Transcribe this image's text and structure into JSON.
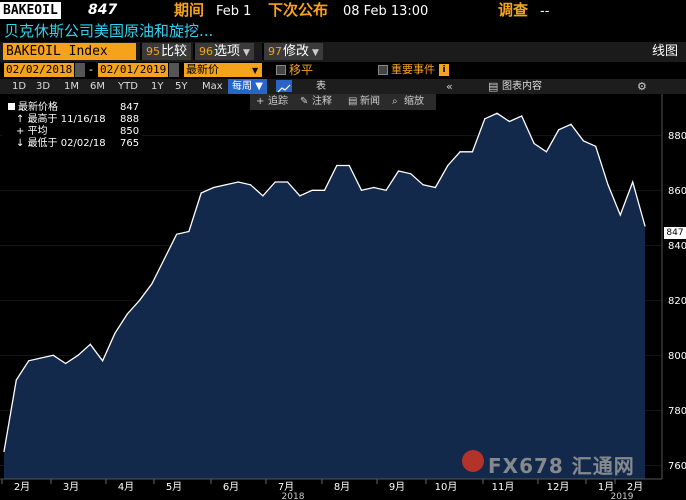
{
  "header": {
    "ticker": "BAKEOIL",
    "price": "847",
    "period_label": "期间",
    "period_value": "Feb 1",
    "next_label": "下次公布",
    "next_value": "08 Feb 13:00",
    "survey_label": "调查",
    "survey_value": "--",
    "name": "贝克休斯公司美国原油和旋挖..."
  },
  "toolbar": {
    "ticker_input": "BAKEOIL Index",
    "compare_num": "95",
    "compare_label": "比较",
    "options_num": "96",
    "options_label": "选项",
    "edit_num": "97",
    "edit_label": "修改",
    "chart_type_label": "线图"
  },
  "range_bar": {
    "start_date": "02/02/2018",
    "end_date": "02/01/2019",
    "price_type": "最新价",
    "moving_label": "移平",
    "events_label": "重要事件"
  },
  "period_bar": {
    "periods": [
      "1D",
      "3D",
      "1M",
      "6M",
      "YTD",
      "1Y",
      "5Y",
      "Max"
    ],
    "frequency": "每周",
    "table_label": "表",
    "chart_content_label": "图表内容"
  },
  "mini_toolbar": {
    "track": "追踪",
    "annotate": "注释",
    "news": "新闻",
    "zoom": "缩放"
  },
  "legend": {
    "last_label": "最新价格",
    "last_value": "847",
    "high_label": "最高于 11/16/18",
    "high_value": "888",
    "avg_label": "平均",
    "avg_value": "850",
    "low_label": "最低于 02/02/18",
    "low_value": "765"
  },
  "watermark": "FX678 汇通网",
  "colors": {
    "orange": "#f6a31c",
    "cyan": "#2fd3f0",
    "area": "#13294b",
    "line": "#ffffff"
  },
  "chart_data": {
    "type": "area",
    "ylim": [
      755,
      895
    ],
    "y_ticks": [
      760,
      780,
      800,
      820,
      840,
      860,
      880
    ],
    "x_ticks": [
      "2月",
      "3月",
      "4月",
      "5月",
      "6月",
      "7月",
      "8月",
      "9月",
      "10月",
      "11月",
      "12月",
      "1月",
      "2月"
    ],
    "year_labels": [
      "2018",
      "2019"
    ],
    "current_value": "847",
    "series": [
      {
        "values": [
          765,
          791,
          798,
          799,
          800,
          797,
          800,
          804,
          798,
          808,
          815,
          820,
          826,
          835,
          844,
          845,
          859,
          861,
          862,
          863,
          862,
          858,
          863,
          863,
          858,
          860,
          860,
          869,
          869,
          860,
          861,
          860,
          867,
          866,
          862,
          861,
          869,
          874,
          874,
          886,
          888,
          885,
          887,
          877,
          874,
          882,
          884,
          878,
          876,
          862,
          851,
          863,
          847
        ]
      }
    ]
  }
}
